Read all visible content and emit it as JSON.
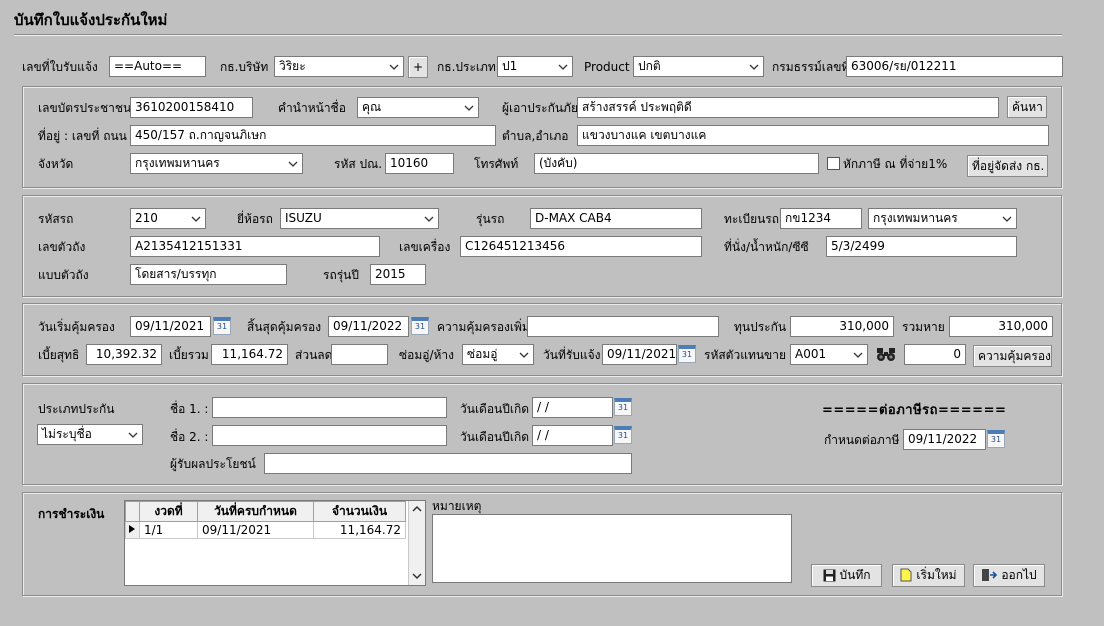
{
  "window": {
    "title": "บันทึกใบแจ้งประกันใหม่"
  },
  "top": {
    "receipt_no_label": "เลขที่ใบรับแจ้ง",
    "receipt_no_value": "==Auto==",
    "company_label": "กธ.บริษัท",
    "company_value": "วิริยะ",
    "add_label": "+",
    "type_label": "กธ.ประเภท",
    "type_value": "ป1",
    "product_label": "Product",
    "product_value": "ปกติ",
    "policy_label": "กรมธรรม์เลขที่",
    "policy_value": "63006/รย/012211"
  },
  "insured": {
    "id_label": "เลขบัตรประชาชน",
    "id_value": "3610200158410",
    "prefix_label": "คำนำหน้าชื่อ",
    "prefix_value": "คุณ",
    "name_label": "ผู้เอาประกันภัย",
    "name_value": "สร้างสรรค์  ประพฤติดี",
    "search_label": "ค้นหา",
    "address_label": "ที่อยู่ : เลขที่ ถนน",
    "address_value": "450/157 ถ.กาญจนภิเษก",
    "district_label": "ตำบล,อำเภอ",
    "district_value": "แขวงบางแค เขตบางแค",
    "province_label": "จังหวัด",
    "province_value": "กรุงเทพมหานคร",
    "postcode_label": "รหัส ปณ.",
    "postcode_value": "10160",
    "phone_label": "โทรศัพท์",
    "phone_value": "(บังคับ)",
    "withhold_label": "หักภาษี ณ ที่จ่าย1%",
    "ship_address_label": "ที่อยู่จัดส่ง กธ."
  },
  "vehicle": {
    "code_label": "รหัสรถ",
    "code_value": "210",
    "brand_label": "ยี่ห้อรถ",
    "brand_value": "ISUZU",
    "model_label": "รุ่นรถ",
    "model_value": "D-MAX CAB4",
    "plate_label": "ทะเบียนรถ",
    "plate_value": "กข1234",
    "plate_province_value": "กรุงเทพมหานคร",
    "chassis_label": "เลขตัวถัง",
    "chassis_value": "A2135412151331",
    "engine_label": "เลขเครื่อง",
    "engine_value": "C126451213456",
    "seats_label": "ที่นั่ง/น้ำหนัก/ซีซี",
    "seats_value": "5/3/2499",
    "body_label": "แบบตัวถัง",
    "body_value": "โดยสาร/บรรทุก",
    "year_label": "รถรุ่นปี",
    "year_value": "2015"
  },
  "coverage": {
    "start_label": "วันเริ่มคุ้มครอง",
    "start_value": "09/11/2021",
    "end_label": "สิ้นสุดคุ้มครอง",
    "end_value": "09/11/2022",
    "extra_label": "ความคุ้มครองเพิ่ม",
    "extra_value": "",
    "sum_label": "ทุนประกัน",
    "sum_value": "310,000",
    "total_loss_label": "รวมหาย",
    "total_loss_value": "310,000",
    "net_label": "เบี้ยสุทธิ",
    "net_value": "10,392.32",
    "gross_label": "เบี้ยรวม",
    "gross_value": "11,164.72",
    "discount_label": "ส่วนลด",
    "discount_value": "",
    "repair_label": "ซ่อมอู่/ห้าง",
    "repair_value": "ซ่อมอู่",
    "notify_label": "วันที่รับแจ้ง",
    "notify_value": "09/11/2021",
    "agent_label": "รหัสตัวแทนขาย",
    "agent_value": "A001",
    "agent_num_value": "0",
    "coverage_btn": "ความคุ้มครอง"
  },
  "drivers": {
    "type_label": "ประเภทประกัน",
    "type_value": "ไม่ระบุชื่อ",
    "name1_label": "ชื่อ 1. :",
    "name1_value": "",
    "name2_label": "ชื่อ 2. :",
    "name2_value": "",
    "dob1_label": "วันเดือนปีเกิด",
    "dob1_value": " / /",
    "dob2_label": "วันเดือนปีเกิด",
    "dob2_value": " / /",
    "beneficiary_label": "ผู้รับผลประโยชน์",
    "beneficiary_value": "",
    "tax_heading": "=====ต่อภาษีรถ======",
    "tax_due_label": "กำหนดต่อภาษี",
    "tax_due_value": "09/11/2022"
  },
  "payment": {
    "label": "การชำระเงิน",
    "columns": [
      "งวดที่",
      "วันที่ครบกำหนด",
      "จำนวนเงิน"
    ],
    "rows": [
      {
        "installment": "1/1",
        "due": "09/11/2021",
        "amount": "11,164.72"
      }
    ],
    "remark_label": "หมายเหตุ",
    "remark_value": ""
  },
  "actions": {
    "save": "บันทึก",
    "new": "เริ่มใหม่",
    "exit": "ออกไป"
  },
  "colors": {
    "background": "#c0c0c0",
    "input": "#ffffff",
    "calendar": "#4d7db8"
  }
}
